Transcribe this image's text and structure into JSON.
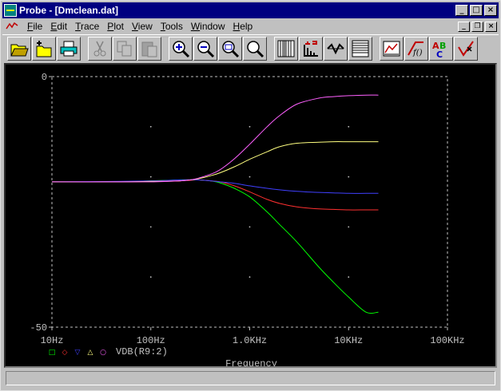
{
  "window": {
    "title": "Probe - [Dmclean.dat]"
  },
  "menu": [
    "File",
    "Edit",
    "Trace",
    "Plot",
    "View",
    "Tools",
    "Window",
    "Help"
  ],
  "menu_underline": [
    "F",
    "E",
    "T",
    "P",
    "V",
    "T",
    "W",
    "H"
  ],
  "toolbar": [
    "open-icon",
    "new-icon",
    "print-icon",
    "cut-icon",
    "copy-icon",
    "paste-icon",
    "zoom-in-icon",
    "zoom-out-icon",
    "zoom-area-icon",
    "zoom-fit-icon",
    "log-x-icon",
    "fourier-icon",
    "performance-icon",
    "log-y-icon",
    "add-trace-icon",
    "eval-goal-icon",
    "label-icon",
    "mark-data-icon"
  ],
  "plot": {
    "y_ticks": [
      "0",
      "-50"
    ],
    "x_ticks": [
      "10Hz",
      "100Hz",
      "1.0KHz",
      "10KHz",
      "100KHz"
    ],
    "xlabel": "Frequency",
    "legend": "VDB(R9:2)",
    "background": "#000000"
  },
  "chart_data": {
    "type": "line",
    "xscale": "log",
    "xlim": [
      10,
      100000
    ],
    "ylim": [
      -50,
      0
    ],
    "x": [
      10,
      50,
      100,
      150,
      200,
      250,
      300,
      400,
      500,
      700,
      1000,
      1500,
      2000,
      3000,
      5000,
      7000,
      10000,
      15000,
      20000
    ],
    "series": [
      {
        "color": "#00ff00",
        "values": [
          -21,
          -21,
          -20.8,
          -20.7,
          -20.6,
          -20.6,
          -20.6,
          -20.8,
          -21.2,
          -22.3,
          -24,
          -27,
          -29.5,
          -33,
          -38,
          -41,
          -44,
          -47,
          -47
        ]
      },
      {
        "color": "#ff3030",
        "values": [
          -21,
          -21,
          -20.9,
          -20.8,
          -20.8,
          -20.7,
          -20.6,
          -20.8,
          -21,
          -21.8,
          -23,
          -24.5,
          -25.3,
          -26,
          -26.4,
          -26.5,
          -26.6,
          -26.6,
          -26.6
        ]
      },
      {
        "color": "#4040ff",
        "values": [
          -21,
          -20.9,
          -20.8,
          -20.7,
          -20.6,
          -20.6,
          -20.6,
          -20.8,
          -21,
          -21.3,
          -21.8,
          -22.3,
          -22.6,
          -22.9,
          -23.1,
          -23.2,
          -23.3,
          -23.3,
          -23.3
        ]
      },
      {
        "color": "#ffff80",
        "values": [
          -21,
          -21,
          -20.9,
          -20.9,
          -20.8,
          -20.6,
          -20.4,
          -19.8,
          -19.2,
          -18,
          -16.5,
          -15,
          -14,
          -13.3,
          -13.1,
          -13,
          -13,
          -13,
          -13
        ]
      },
      {
        "color": "#ff60ff",
        "values": [
          -21,
          -21,
          -21,
          -20.9,
          -20.8,
          -20.6,
          -20.3,
          -19.5,
          -18.6,
          -16.4,
          -13.5,
          -10,
          -7.8,
          -5.5,
          -4.3,
          -4,
          -3.8,
          -3.7,
          -3.7
        ]
      }
    ]
  }
}
